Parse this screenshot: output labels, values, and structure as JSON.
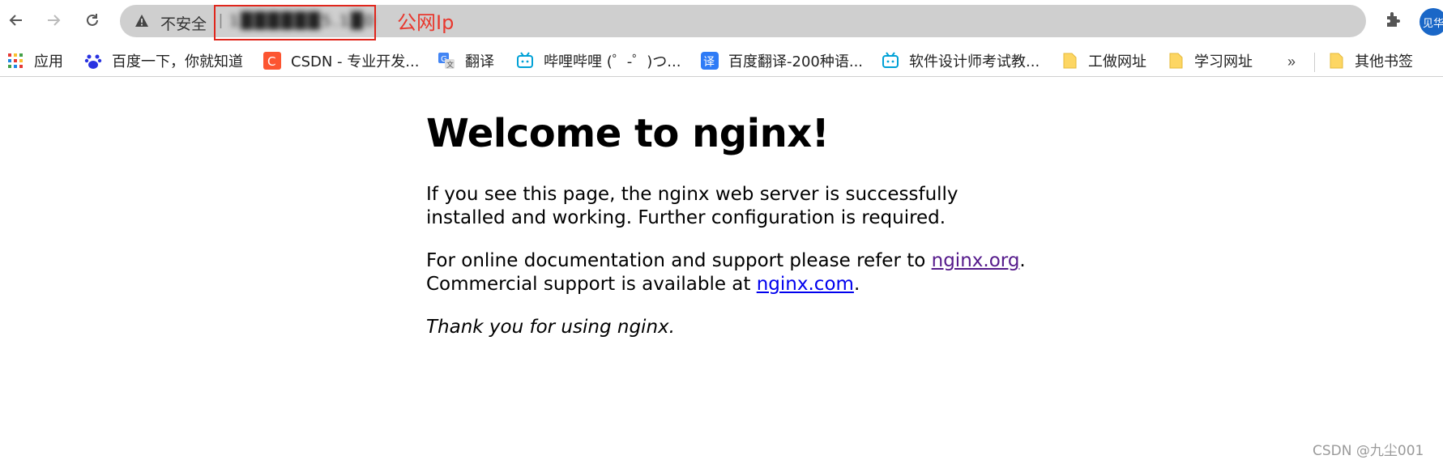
{
  "browser": {
    "security_label": "不安全",
    "separator": "|",
    "url_blurred": "1██████5.1█0",
    "annotation": "公网Ip",
    "avatar_text": "见华"
  },
  "bookmarks": [
    {
      "label": "应用",
      "icon": "apps-grid-icon"
    },
    {
      "label": "百度一下，你就知道",
      "icon": "baidu-icon"
    },
    {
      "label": "CSDN - 专业开发...",
      "icon": "csdn-icon"
    },
    {
      "label": "翻译",
      "icon": "google-translate-icon"
    },
    {
      "label": "哔哩哔哩 (゜-゜)つ...",
      "icon": "bilibili-icon"
    },
    {
      "label": "百度翻译-200种语...",
      "icon": "baidu-translate-icon"
    },
    {
      "label": "软件设计师考试教...",
      "icon": "bilibili-icon"
    },
    {
      "label": "工做网址",
      "icon": "folder-icon"
    },
    {
      "label": "学习网址",
      "icon": "folder-icon"
    },
    {
      "label": "其他书签",
      "icon": "folder-icon"
    }
  ],
  "overflow_label": "»",
  "page": {
    "title": "Welcome to nginx!",
    "p1": "If you see this page, the nginx web server is successfully installed and working. Further configuration is required.",
    "p2_prefix": "For online documentation and support please refer to ",
    "link_org": "nginx.org",
    "p2_mid": ".",
    "p2_line2_prefix": "Commercial support is available at ",
    "link_com": "nginx.com",
    "p2_suffix": ".",
    "p3": "Thank you for using nginx."
  },
  "watermark": "CSDN @九尘001",
  "colors": {
    "annotation_red": "#e8382e",
    "visited_link": "#551a8b",
    "link": "#0000ee",
    "avatar_bg": "#1a67c7"
  }
}
